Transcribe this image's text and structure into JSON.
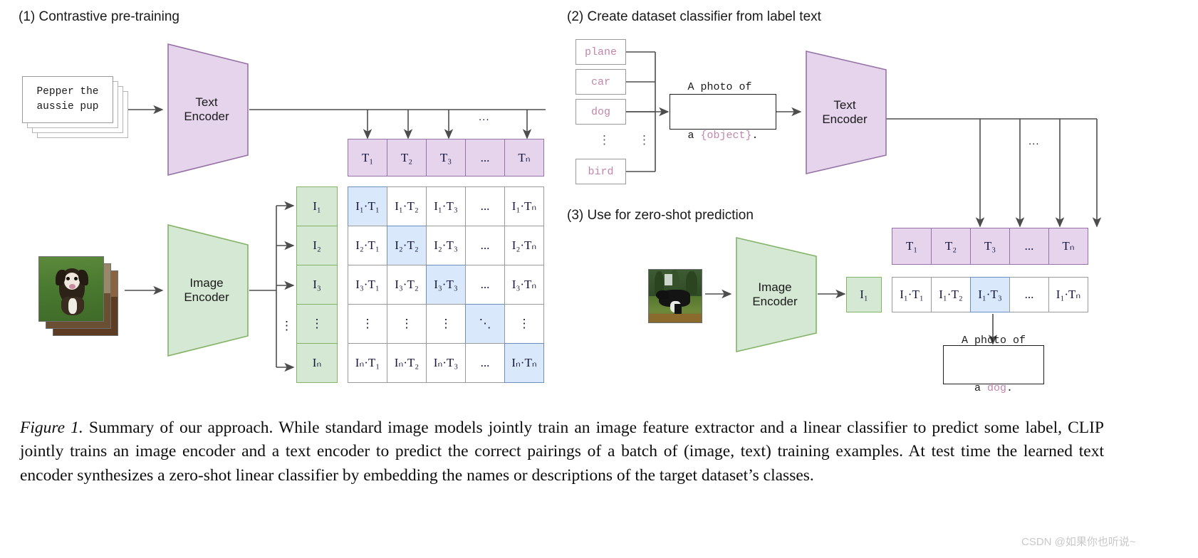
{
  "panels": {
    "p1": {
      "title": "(1) Contrastive pre-training"
    },
    "p2": {
      "title": "(2) Create dataset classifier from label text"
    },
    "p3": {
      "title": "(3) Use for zero-shot prediction"
    }
  },
  "encoders": {
    "text_line1": "Text",
    "text_line2": "Encoder",
    "image_line1": "Image",
    "image_line2": "Encoder"
  },
  "inputs": {
    "caption_text": "Pepper the\naussie pup",
    "photo_alt_train": "puppy-photo",
    "photo_alt_test": "dog-photo"
  },
  "labels": {
    "items": [
      "plane",
      "car",
      "dog",
      "bird"
    ],
    "ellipsis": "⋮"
  },
  "prompt": {
    "template_prefix": "A photo of",
    "template_suffix": "a ",
    "template_object": "{object}",
    "template_end": ".",
    "result_prefix": "A photo of",
    "result_suffix": "a ",
    "result_object": "dog",
    "result_end": "."
  },
  "text_embeddings": {
    "headers": [
      "T",
      "T",
      "T",
      "...",
      "T"
    ],
    "subs": [
      "1",
      "2",
      "3",
      "",
      "N"
    ],
    "labels": [
      "T₁",
      "T₂",
      "T₃",
      "...",
      "Tₙ"
    ]
  },
  "image_embeddings": {
    "labels": [
      "I₁",
      "I₂",
      "I₃",
      "⋮",
      "Iₙ"
    ]
  },
  "matrix": {
    "row_index": [
      "1",
      "2",
      "3",
      "",
      "N"
    ],
    "col_index": [
      "1",
      "2",
      "3",
      "",
      "N"
    ],
    "dot": "·",
    "col_dots": "...",
    "vertical_dots": "⋮",
    "diag_dots": "⋱",
    "rows": [
      [
        "I₁·T₁",
        "I₁·T₂",
        "I₁·T₃",
        "...",
        "I₁·Tₙ"
      ],
      [
        "I₂·T₁",
        "I₂·T₂",
        "I₂·T₃",
        "...",
        "I₂·Tₙ"
      ],
      [
        "I₃·T₁",
        "I₃·T₂",
        "I₃·T₃",
        "...",
        "I₃·Tₙ"
      ],
      [
        "⋮",
        "⋮",
        "⋮",
        "⋱",
        "⋮"
      ],
      [
        "Iₙ·T₁",
        "Iₙ·T₂",
        "Iₙ·T₃",
        "...",
        "Iₙ·Tₙ"
      ]
    ],
    "diagonal_cells": [
      [
        0,
        0
      ],
      [
        1,
        1
      ],
      [
        2,
        2
      ],
      [
        3,
        3
      ],
      [
        4,
        4
      ]
    ]
  },
  "zeroshot_row": {
    "cells": [
      "I₁·T₁",
      "I₁·T₂",
      "I₁·T₃",
      "...",
      "I₁·Tₙ"
    ],
    "highlighted_index": 2,
    "image_embedding": "I₁"
  },
  "caption": {
    "figure_label": "Figure 1.",
    "body": " Summary of our approach. While standard image models jointly train an image feature extractor and a linear classifier to predict some label, CLIP jointly trains an image encoder and a text encoder to predict the correct pairings of a batch of (image, text) training examples. At test time the learned text encoder synthesizes a zero-shot linear classifier by embedding the names or descriptions of the target dataset’s classes."
  },
  "watermark": {
    "text": "CSDN @如果你也听说~"
  },
  "colors": {
    "purple_fill": "#e5d4ec",
    "purple_border": "#9673a6",
    "green_fill": "#d5e8d4",
    "green_border": "#82b366",
    "blue_fill": "#dae8fc",
    "blue_border": "#6c8ebf",
    "grey_border": "#9a9a9a",
    "label_pink": "#c285ad",
    "arrow": "#4d4d4d"
  }
}
